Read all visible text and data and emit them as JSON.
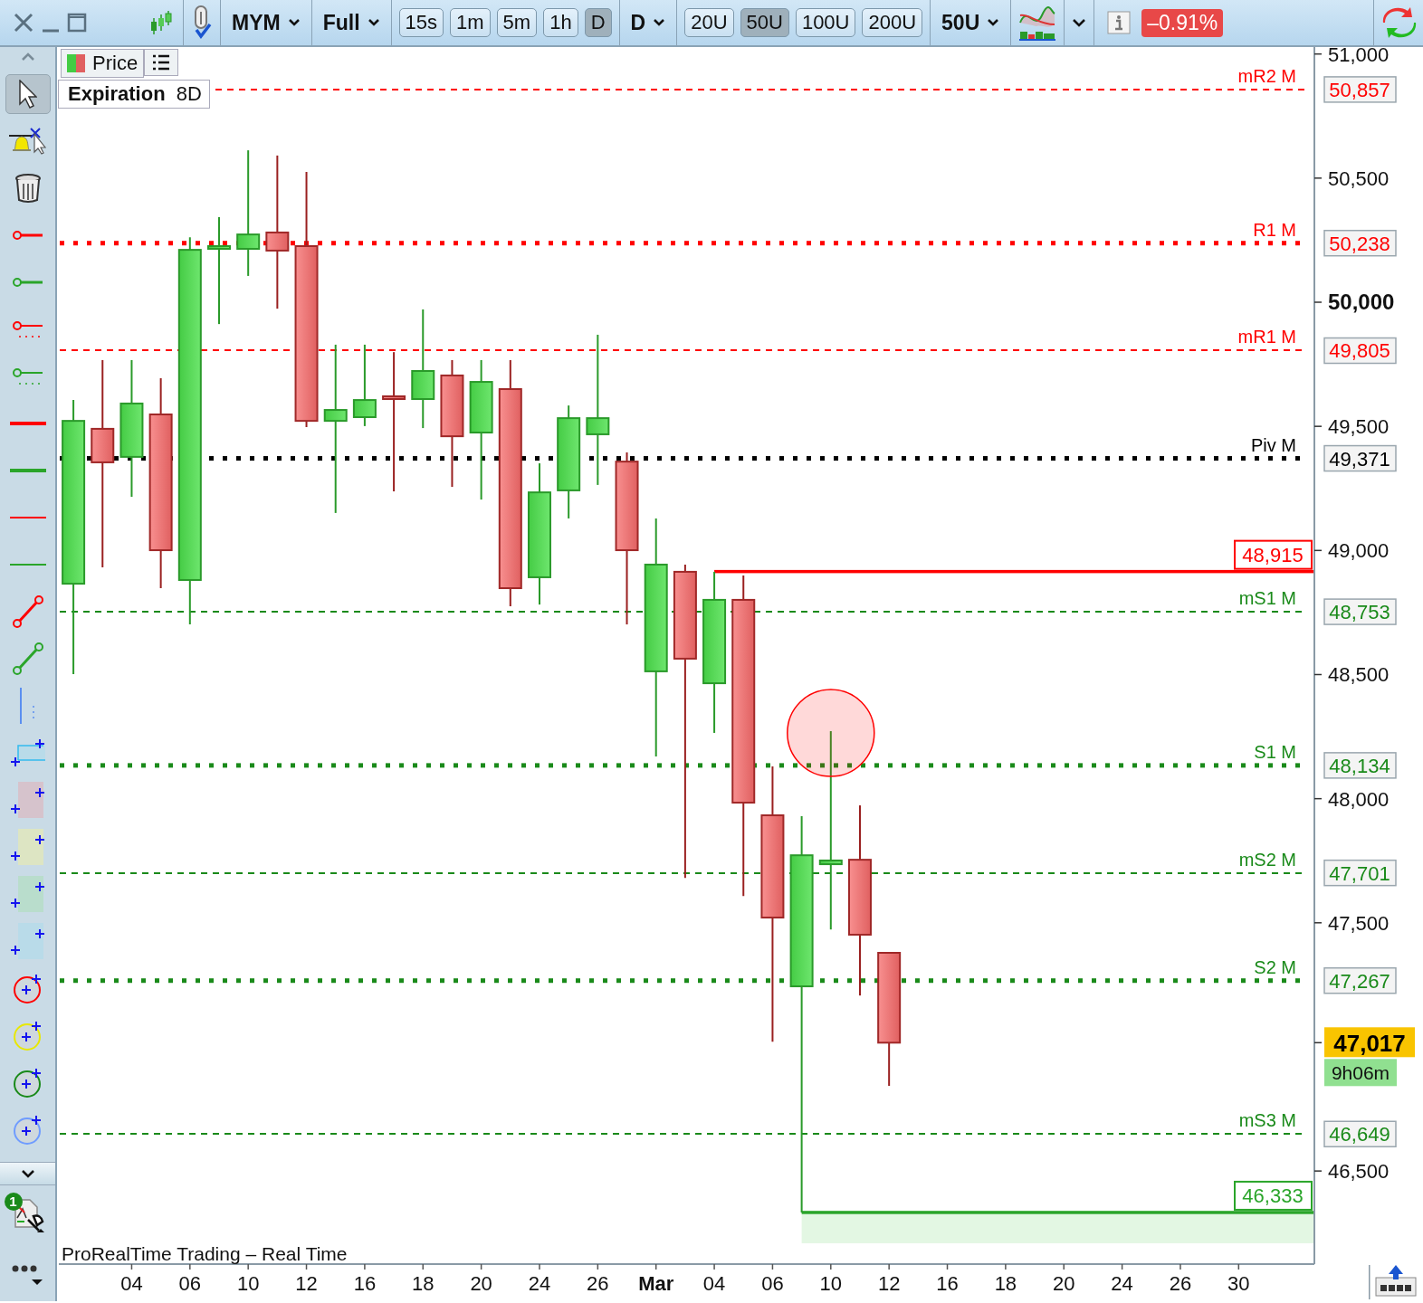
{
  "toolbar": {
    "symbol": "MYM",
    "view": "Full",
    "timeframes": [
      {
        "label": "15s",
        "selected": false
      },
      {
        "label": "1m",
        "selected": false
      },
      {
        "label": "5m",
        "selected": false
      },
      {
        "label": "1h",
        "selected": false
      },
      {
        "label": "D",
        "selected": true
      }
    ],
    "period": "D",
    "units": [
      {
        "label": "20U",
        "selected": false
      },
      {
        "label": "50U",
        "selected": true
      },
      {
        "label": "100U",
        "selected": false
      },
      {
        "label": "200U",
        "selected": false
      }
    ],
    "units_menu": "50U",
    "change": "–0.91%"
  },
  "tools": [
    {
      "kind": "pointer",
      "selected": true
    },
    {
      "kind": "alert",
      "selected": false
    },
    {
      "kind": "trash",
      "selected": false
    },
    {
      "kind": "ray",
      "color": "#ff0000",
      "selected": false
    },
    {
      "kind": "ray",
      "color": "#2aa52a",
      "selected": false
    },
    {
      "kind": "dotted-ray",
      "color": "#ff0000",
      "selected": false
    },
    {
      "kind": "dotted-ray",
      "color": "#2aa52a",
      "selected": false
    },
    {
      "kind": "thick-line",
      "color": "#ff0000",
      "selected": false
    },
    {
      "kind": "thick-line",
      "color": "#2aa52a",
      "selected": false
    },
    {
      "kind": "line",
      "color": "#ff0000",
      "selected": false
    },
    {
      "kind": "line",
      "color": "#2aa52a",
      "selected": false
    },
    {
      "kind": "segment",
      "color": "#ff0000",
      "selected": false
    },
    {
      "kind": "segment",
      "color": "#2aa52a",
      "selected": false
    },
    {
      "kind": "vline",
      "selected": false
    },
    {
      "kind": "rectangle",
      "selected": false
    },
    {
      "kind": "zone",
      "color": "#d6c3cc",
      "selected": false
    },
    {
      "kind": "zone",
      "color": "#dde5c3",
      "selected": false
    },
    {
      "kind": "zone",
      "color": "#b9ddcc",
      "selected": false
    },
    {
      "kind": "zone",
      "color": "#b9dbe9",
      "selected": false
    },
    {
      "kind": "ellipse",
      "color": "#ff0000",
      "selected": false
    },
    {
      "kind": "ellipse",
      "color": "#e8e800",
      "selected": false
    },
    {
      "kind": "ellipse",
      "color": "#1a8a1a",
      "selected": false
    },
    {
      "kind": "ellipse",
      "color": "#6f9cff",
      "selected": false
    }
  ],
  "settings_badge": "1",
  "chart": {
    "legend": "Price",
    "expiration": {
      "label": "Expiration",
      "value": "8D"
    },
    "footer": "ProRealTime Trading – Real Time",
    "last": {
      "value": "47,017",
      "countdown": "9h06m"
    },
    "price_axis": [
      {
        "label": "51,000",
        "bold": false
      },
      {
        "label": "50,500",
        "bold": false
      },
      {
        "label": "50,000",
        "bold": true
      },
      {
        "label": "49,500",
        "bold": false
      },
      {
        "label": "49,000",
        "bold": false
      },
      {
        "label": "48,500",
        "bold": false
      },
      {
        "label": "48,000",
        "bold": false
      },
      {
        "label": "47,500",
        "bold": false
      },
      {
        "label": "46,500",
        "bold": false
      }
    ],
    "date_axis": [
      {
        "label": "04",
        "bold": false
      },
      {
        "label": "06",
        "bold": false
      },
      {
        "label": "10",
        "bold": false
      },
      {
        "label": "12",
        "bold": false
      },
      {
        "label": "16",
        "bold": false
      },
      {
        "label": "18",
        "bold": false
      },
      {
        "label": "20",
        "bold": false
      },
      {
        "label": "24",
        "bold": false
      },
      {
        "label": "26",
        "bold": false
      },
      {
        "label": "Mar",
        "bold": true
      },
      {
        "label": "04",
        "bold": false
      },
      {
        "label": "06",
        "bold": false
      },
      {
        "label": "10",
        "bold": false
      },
      {
        "label": "12",
        "bold": false
      },
      {
        "label": "16",
        "bold": false
      },
      {
        "label": "18",
        "bold": false
      },
      {
        "label": "20",
        "bold": false
      },
      {
        "label": "24",
        "bold": false
      },
      {
        "label": "26",
        "bold": false
      },
      {
        "label": "30",
        "bold": false
      }
    ],
    "levels": [
      {
        "label": "mR2 M",
        "price": "50,857",
        "color": "#ff0000",
        "kind": "mid"
      },
      {
        "label": "R1 M",
        "price": "50,238",
        "color": "#ff0000",
        "kind": "main"
      },
      {
        "label": "mR1 M",
        "price": "49,805",
        "color": "#ff0000",
        "kind": "mid"
      },
      {
        "label": "Piv M",
        "price": "49,371",
        "color": "#000000",
        "kind": "main"
      },
      {
        "label": "mS1 M",
        "price": "48,753",
        "color": "#1a8a1a",
        "kind": "mid"
      },
      {
        "label": "S1 M",
        "price": "48,134",
        "color": "#1a8a1a",
        "kind": "main"
      },
      {
        "label": "mS2 M",
        "price": "47,701",
        "color": "#1a8a1a",
        "kind": "mid"
      },
      {
        "label": "S2 M",
        "price": "47,267",
        "color": "#1a8a1a",
        "kind": "main"
      },
      {
        "label": "mS3 M",
        "price": "46,649",
        "color": "#1a8a1a",
        "kind": "mid"
      }
    ],
    "drawings": [
      {
        "kind": "hline",
        "price": "48,915",
        "color": "#ff0000"
      },
      {
        "kind": "zone",
        "price": "46,333",
        "color": "#2aa52a"
      },
      {
        "kind": "circle",
        "color": "#ff0000"
      }
    ]
  }
}
